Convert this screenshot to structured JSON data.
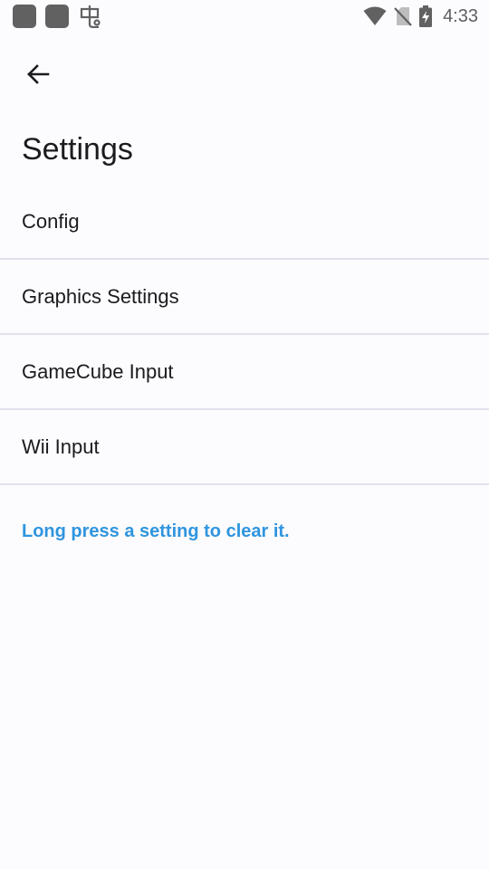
{
  "status_bar": {
    "time": "4:33",
    "icons": [
      "notification-square-icon",
      "notification-square-icon",
      "bug-icon",
      "wifi-icon",
      "no-sim-icon",
      "battery-charging-icon"
    ]
  },
  "toolbar": {
    "back_icon": "arrow-left-icon"
  },
  "page": {
    "title": "Settings"
  },
  "settings_list": {
    "items": [
      {
        "label": "Config"
      },
      {
        "label": "Graphics Settings"
      },
      {
        "label": "GameCube Input"
      },
      {
        "label": "Wii Input"
      }
    ]
  },
  "hint": {
    "text": "Long press a setting to clear it."
  },
  "colors": {
    "background": "#fcfbfe",
    "divider": "#e2e1ec",
    "hint": "#2f95de",
    "text": "#1b1b1f"
  }
}
